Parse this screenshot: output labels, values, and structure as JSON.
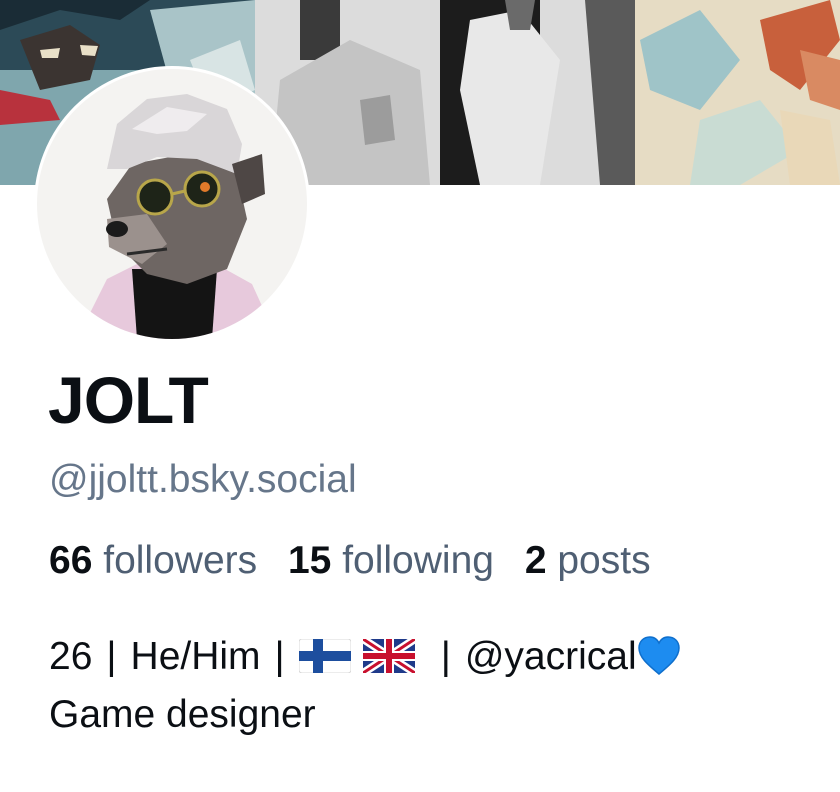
{
  "profile": {
    "display_name": "JOLT",
    "handle": "@jjoltt.bsky.social",
    "stats": [
      {
        "count": "66",
        "label": "followers"
      },
      {
        "count": "15",
        "label": "following"
      },
      {
        "count": "2",
        "label": "posts"
      }
    ],
    "bio": {
      "age": "26",
      "pronouns": "He/Him",
      "separator": "|",
      "flags": [
        "finland-flag-icon",
        "uk-flag-icon"
      ],
      "mention": "@yacrical",
      "heart": "blue-heart-icon",
      "line2": "Game designer"
    }
  },
  "colors": {
    "name": "#0b0f14",
    "handle": "#66768a",
    "stat_label": "#4f5f73",
    "heart": "#1d8cf0"
  }
}
